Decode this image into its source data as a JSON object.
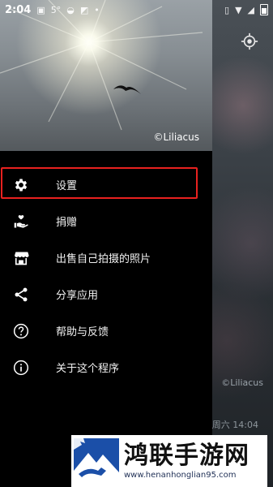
{
  "status_bar": {
    "time": "2:04",
    "temp": "5°",
    "dot": "•"
  },
  "background": {
    "credit": "©Liliacus",
    "date_time": "周六 14:04"
  },
  "drawer": {
    "header_credit": "©Liliacus",
    "items": [
      {
        "label": "设置",
        "icon": "gear-icon",
        "selected": true
      },
      {
        "label": "捐赠",
        "icon": "donate-hand-heart-icon"
      },
      {
        "label": "出售自己拍摄的照片",
        "icon": "store-icon"
      },
      {
        "label": "分享应用",
        "icon": "share-icon"
      },
      {
        "label": "帮助与反馈",
        "icon": "help-icon"
      },
      {
        "label": "关于这个程序",
        "icon": "info-icon"
      }
    ]
  },
  "watermark": {
    "title": "鸿联手游网",
    "url": "www.henanhonglian95.com"
  },
  "colors": {
    "highlight": "#e8211f",
    "drawer_bg": "#000000"
  }
}
